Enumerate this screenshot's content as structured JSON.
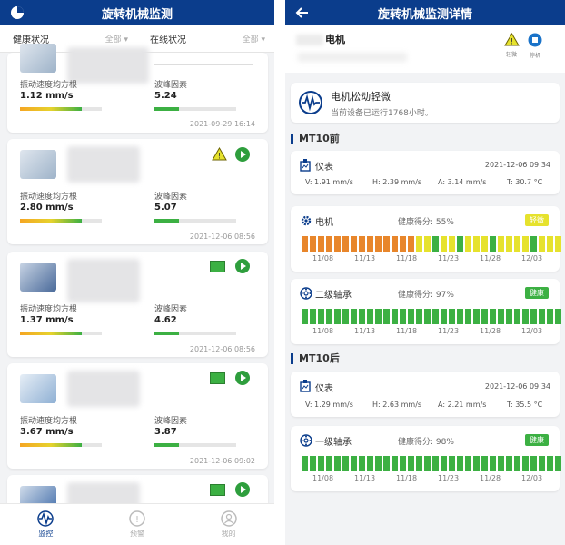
{
  "colors": {
    "primary": "#0b3d8c",
    "ok": "#3cb043",
    "warn_orange": "#e8862b",
    "warn_yellow": "#e6e22d",
    "badge_warn": "#e6e22d",
    "badge_ok": "#3cb043"
  },
  "left": {
    "title": "旋转机械监测",
    "filters": [
      {
        "label": "健康状况",
        "value": "全部"
      },
      {
        "label": "在线状况",
        "value": "全部"
      }
    ],
    "cards": [
      {
        "metric1_label": "振动速度均方根",
        "metric1_value": "1.12 mm/s",
        "metric2_label": "波峰因素",
        "metric2_value": "5.24",
        "date": "2021-09-29 16:14",
        "bar1_level": 0.75,
        "bar2_level": 0.3
      },
      {
        "metric1_label": "振动速度均方根",
        "metric1_value": "2.80 mm/s",
        "metric2_label": "波峰因素",
        "metric2_value": "5.07",
        "date": "2021-12-06 08:56",
        "bar1_level": 0.75,
        "bar2_level": 0.3,
        "status": "warning"
      },
      {
        "metric1_label": "振动速度均方根",
        "metric1_value": "1.37 mm/s",
        "metric2_label": "波峰因素",
        "metric2_value": "4.62",
        "date": "2021-12-06 08:56",
        "bar1_level": 0.75,
        "bar2_level": 0.3,
        "status": "ok"
      },
      {
        "metric1_label": "振动速度均方根",
        "metric1_value": "3.67 mm/s",
        "metric2_label": "波峰因素",
        "metric2_value": "3.87",
        "date": "2021-12-06 09:02",
        "bar1_level": 0.75,
        "bar2_level": 0.3,
        "status": "ok"
      }
    ],
    "tabs": [
      {
        "label": "监控",
        "icon": "monitor-wave-icon"
      },
      {
        "label": "预警",
        "icon": "alert-icon"
      },
      {
        "label": "我的",
        "icon": "user-icon"
      }
    ]
  },
  "right": {
    "title": "旋转机械监测详情",
    "device_name": "电机",
    "top_icons": [
      {
        "label": "轻微",
        "icon": "warning-icon"
      },
      {
        "label": "停机",
        "icon": "stop-icon"
      }
    ],
    "diagnosis": {
      "title": "电机松动轻微",
      "desc": "当前设备已运行1768小时。"
    },
    "sections": [
      {
        "title": "MT10前",
        "meter": {
          "label": "仪表",
          "date": "2021-12-06 09:34",
          "V": "V:  1.91 mm/s",
          "H": "H:  2.39 mm/s",
          "A": "A:  3.14 mm/s",
          "T": "T:  30.7 °C"
        },
        "parts": [
          {
            "name": "电机",
            "score": "健康得分: 55%",
            "badge": "轻微",
            "badge_color": "#e6e22d",
            "segments": [
              "o",
              "o",
              "o",
              "o",
              "o",
              "o",
              "o",
              "o",
              "o",
              "o",
              "o",
              "o",
              "o",
              "o",
              "y",
              "y",
              "g",
              "y",
              "y",
              "g",
              "y",
              "y",
              "y",
              "g",
              "y",
              "y",
              "y",
              "y",
              "g",
              "y",
              "y",
              "y"
            ]
          },
          {
            "name": "二级轴承",
            "score": "健康得分: 97%",
            "badge": "健康",
            "badge_color": "#3cb043",
            "segments": [
              "g",
              "g",
              "g",
              "g",
              "g",
              "g",
              "g",
              "g",
              "g",
              "g",
              "g",
              "g",
              "g",
              "g",
              "g",
              "g",
              "g",
              "g",
              "g",
              "g",
              "g",
              "g",
              "g",
              "g",
              "g",
              "g",
              "g",
              "g",
              "g",
              "g",
              "g",
              "g"
            ]
          }
        ]
      },
      {
        "title": "MT10后",
        "meter": {
          "label": "仪表",
          "date": "2021-12-06 09:34",
          "V": "V:  1.29 mm/s",
          "H": "H:  2.63 mm/s",
          "A": "A:  2.21 mm/s",
          "T": "T:  35.5 °C"
        },
        "parts": [
          {
            "name": "一级轴承",
            "score": "健康得分: 98%",
            "badge": "健康",
            "badge_color": "#3cb043",
            "segments": [
              "g",
              "g",
              "g",
              "g",
              "g",
              "g",
              "g",
              "g",
              "g",
              "g",
              "g",
              "g",
              "g",
              "g",
              "g",
              "g",
              "g",
              "g",
              "g",
              "g",
              "g",
              "g",
              "g",
              "g",
              "g",
              "g",
              "g",
              "g",
              "g",
              "g",
              "g",
              "g"
            ]
          }
        ]
      }
    ],
    "dates": [
      "11/08",
      "11/13",
      "11/18",
      "11/23",
      "11/28",
      "12/03"
    ]
  }
}
